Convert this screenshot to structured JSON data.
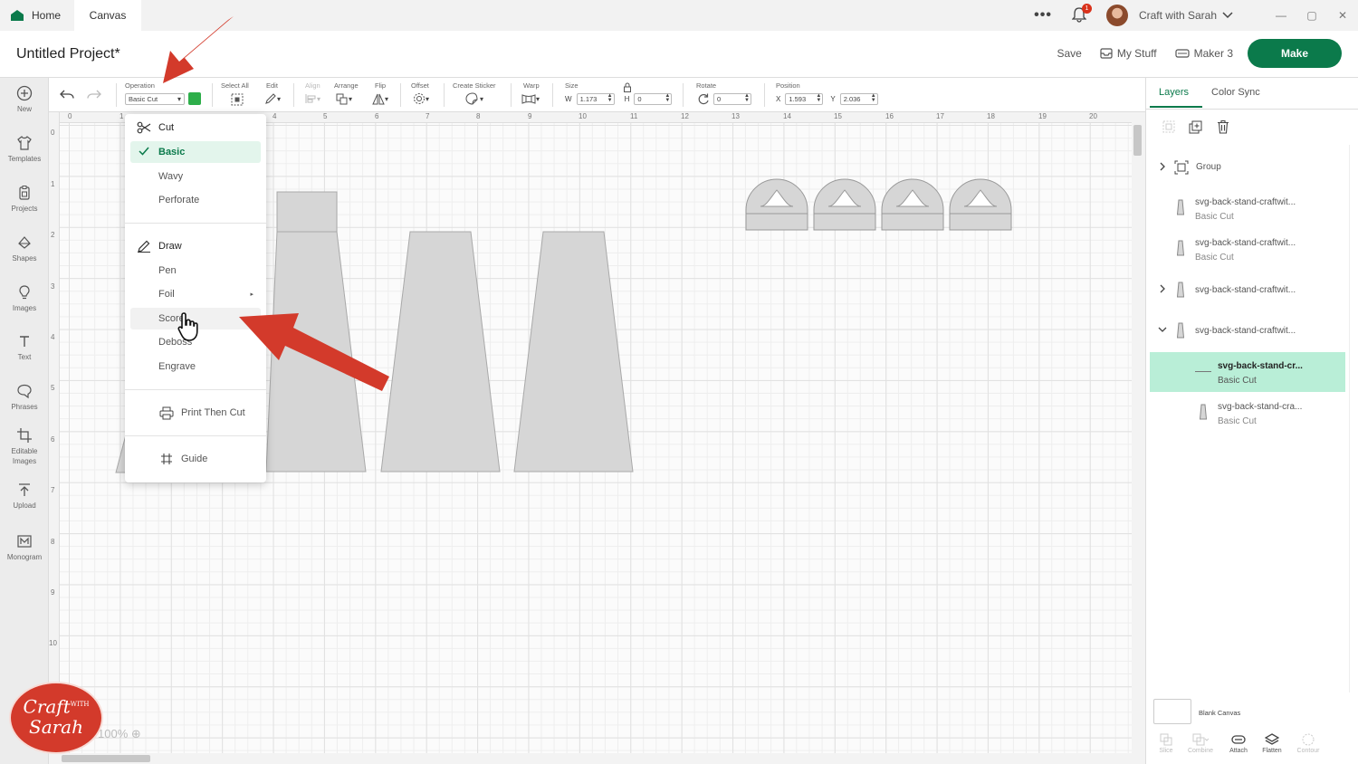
{
  "tabs": {
    "home": "Home",
    "canvas": "Canvas"
  },
  "account": {
    "notifications": "1",
    "name": "Craft with Sarah"
  },
  "project": {
    "title": "Untitled Project*"
  },
  "header": {
    "save": "Save",
    "my_stuff": "My Stuff",
    "machine": "Maker 3",
    "make": "Make"
  },
  "sidebar": {
    "items": [
      {
        "label": "New",
        "icon": "plus-circle-icon"
      },
      {
        "label": "Templates",
        "icon": "shirt-icon"
      },
      {
        "label": "Projects",
        "icon": "clipboard-icon"
      },
      {
        "label": "Shapes",
        "icon": "shapes-icon"
      },
      {
        "label": "Images",
        "icon": "bulb-icon"
      },
      {
        "label": "Text",
        "icon": "text-icon"
      },
      {
        "label": "Phrases",
        "icon": "speech-icon"
      },
      {
        "label": "Editable Images",
        "icon": "crop-icon"
      },
      {
        "label": "Upload",
        "icon": "upload-icon"
      },
      {
        "label": "Monogram",
        "icon": "monogram-icon"
      }
    ]
  },
  "toolbar": {
    "operation_label": "Operation",
    "operation_value": "Basic Cut",
    "operation_color": "#2dae4a",
    "select_all": "Select All",
    "edit": "Edit",
    "align": "Align",
    "arrange": "Arrange",
    "flip": "Flip",
    "offset": "Offset",
    "create_sticker": "Create Sticker",
    "warp": "Warp",
    "size": "Size",
    "w_label": "W",
    "w_value": "1.173",
    "h_label": "H",
    "h_value": "0",
    "rotate": "Rotate",
    "rotate_value": "0",
    "position": "Position",
    "x_label": "X",
    "x_value": "1.593",
    "y_label": "Y",
    "y_value": "2.036"
  },
  "ruler": {
    "top": [
      "0",
      "1",
      "",
      "",
      "4",
      "5",
      "6",
      "7",
      "8",
      "9",
      "10",
      "11",
      "12",
      "13",
      "14",
      "15",
      "16",
      "17",
      "18",
      "19",
      "20"
    ],
    "left": [
      "0",
      "1",
      "2",
      "3",
      "4",
      "5",
      "6",
      "7",
      "8",
      "9",
      "10"
    ]
  },
  "zoom": "100%",
  "menu": {
    "cut": "Cut",
    "basic": "Basic",
    "wavy": "Wavy",
    "perforate": "Perforate",
    "draw": "Draw",
    "pen": "Pen",
    "foil": "Foil",
    "score": "Score",
    "deboss": "Deboss",
    "engrave": "Engrave",
    "print_then_cut": "Print Then Cut",
    "guide": "Guide"
  },
  "panel": {
    "tabs": {
      "layers": "Layers",
      "color_sync": "Color Sync"
    },
    "group": "Group",
    "layers": [
      {
        "name": "svg-back-stand-craftwit...",
        "op": "Basic Cut"
      },
      {
        "name": "svg-back-stand-craftwit...",
        "op": "Basic Cut"
      },
      {
        "name": "svg-back-stand-craftwit...",
        "op": ""
      },
      {
        "name": "svg-back-stand-craftwit...",
        "op": ""
      },
      {
        "name": "svg-back-stand-cr...",
        "op": "Basic Cut"
      },
      {
        "name": "svg-back-stand-cra...",
        "op": "Basic Cut"
      }
    ],
    "blank_canvas": "Blank Canvas",
    "bottom_tools": {
      "slice": "Slice",
      "combine": "Combine",
      "attach": "Attach",
      "flatten": "Flatten",
      "contour": "Contour"
    }
  },
  "logo": {
    "line1": "Craft",
    "with": "WITH",
    "line2": "Sarah"
  },
  "colors": {
    "accent": "#0b7a4b",
    "selection": "#b9eed7",
    "arrow": "#d33a2b",
    "shape_fill": "#d6d6d6"
  }
}
